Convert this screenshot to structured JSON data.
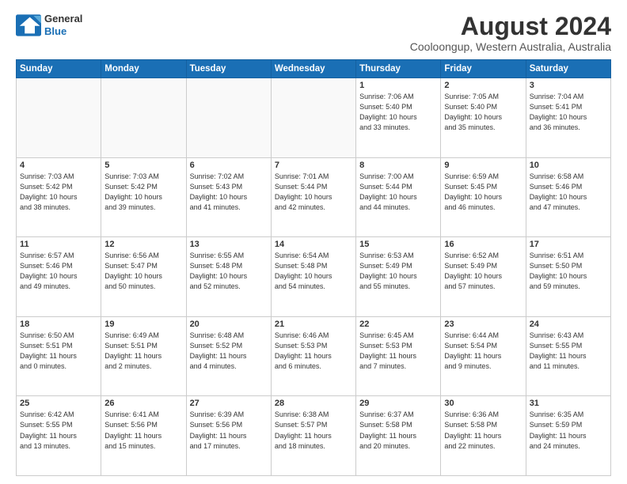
{
  "header": {
    "logo_line1": "General",
    "logo_line2": "Blue",
    "month_title": "August 2024",
    "location": "Cooloongup, Western Australia, Australia"
  },
  "days_of_week": [
    "Sunday",
    "Monday",
    "Tuesday",
    "Wednesday",
    "Thursday",
    "Friday",
    "Saturday"
  ],
  "weeks": [
    [
      {
        "num": "",
        "info": ""
      },
      {
        "num": "",
        "info": ""
      },
      {
        "num": "",
        "info": ""
      },
      {
        "num": "",
        "info": ""
      },
      {
        "num": "1",
        "info": "Sunrise: 7:06 AM\nSunset: 5:40 PM\nDaylight: 10 hours\nand 33 minutes."
      },
      {
        "num": "2",
        "info": "Sunrise: 7:05 AM\nSunset: 5:40 PM\nDaylight: 10 hours\nand 35 minutes."
      },
      {
        "num": "3",
        "info": "Sunrise: 7:04 AM\nSunset: 5:41 PM\nDaylight: 10 hours\nand 36 minutes."
      }
    ],
    [
      {
        "num": "4",
        "info": "Sunrise: 7:03 AM\nSunset: 5:42 PM\nDaylight: 10 hours\nand 38 minutes."
      },
      {
        "num": "5",
        "info": "Sunrise: 7:03 AM\nSunset: 5:42 PM\nDaylight: 10 hours\nand 39 minutes."
      },
      {
        "num": "6",
        "info": "Sunrise: 7:02 AM\nSunset: 5:43 PM\nDaylight: 10 hours\nand 41 minutes."
      },
      {
        "num": "7",
        "info": "Sunrise: 7:01 AM\nSunset: 5:44 PM\nDaylight: 10 hours\nand 42 minutes."
      },
      {
        "num": "8",
        "info": "Sunrise: 7:00 AM\nSunset: 5:44 PM\nDaylight: 10 hours\nand 44 minutes."
      },
      {
        "num": "9",
        "info": "Sunrise: 6:59 AM\nSunset: 5:45 PM\nDaylight: 10 hours\nand 46 minutes."
      },
      {
        "num": "10",
        "info": "Sunrise: 6:58 AM\nSunset: 5:46 PM\nDaylight: 10 hours\nand 47 minutes."
      }
    ],
    [
      {
        "num": "11",
        "info": "Sunrise: 6:57 AM\nSunset: 5:46 PM\nDaylight: 10 hours\nand 49 minutes."
      },
      {
        "num": "12",
        "info": "Sunrise: 6:56 AM\nSunset: 5:47 PM\nDaylight: 10 hours\nand 50 minutes."
      },
      {
        "num": "13",
        "info": "Sunrise: 6:55 AM\nSunset: 5:48 PM\nDaylight: 10 hours\nand 52 minutes."
      },
      {
        "num": "14",
        "info": "Sunrise: 6:54 AM\nSunset: 5:48 PM\nDaylight: 10 hours\nand 54 minutes."
      },
      {
        "num": "15",
        "info": "Sunrise: 6:53 AM\nSunset: 5:49 PM\nDaylight: 10 hours\nand 55 minutes."
      },
      {
        "num": "16",
        "info": "Sunrise: 6:52 AM\nSunset: 5:49 PM\nDaylight: 10 hours\nand 57 minutes."
      },
      {
        "num": "17",
        "info": "Sunrise: 6:51 AM\nSunset: 5:50 PM\nDaylight: 10 hours\nand 59 minutes."
      }
    ],
    [
      {
        "num": "18",
        "info": "Sunrise: 6:50 AM\nSunset: 5:51 PM\nDaylight: 11 hours\nand 0 minutes."
      },
      {
        "num": "19",
        "info": "Sunrise: 6:49 AM\nSunset: 5:51 PM\nDaylight: 11 hours\nand 2 minutes."
      },
      {
        "num": "20",
        "info": "Sunrise: 6:48 AM\nSunset: 5:52 PM\nDaylight: 11 hours\nand 4 minutes."
      },
      {
        "num": "21",
        "info": "Sunrise: 6:46 AM\nSunset: 5:53 PM\nDaylight: 11 hours\nand 6 minutes."
      },
      {
        "num": "22",
        "info": "Sunrise: 6:45 AM\nSunset: 5:53 PM\nDaylight: 11 hours\nand 7 minutes."
      },
      {
        "num": "23",
        "info": "Sunrise: 6:44 AM\nSunset: 5:54 PM\nDaylight: 11 hours\nand 9 minutes."
      },
      {
        "num": "24",
        "info": "Sunrise: 6:43 AM\nSunset: 5:55 PM\nDaylight: 11 hours\nand 11 minutes."
      }
    ],
    [
      {
        "num": "25",
        "info": "Sunrise: 6:42 AM\nSunset: 5:55 PM\nDaylight: 11 hours\nand 13 minutes."
      },
      {
        "num": "26",
        "info": "Sunrise: 6:41 AM\nSunset: 5:56 PM\nDaylight: 11 hours\nand 15 minutes."
      },
      {
        "num": "27",
        "info": "Sunrise: 6:39 AM\nSunset: 5:56 PM\nDaylight: 11 hours\nand 17 minutes."
      },
      {
        "num": "28",
        "info": "Sunrise: 6:38 AM\nSunset: 5:57 PM\nDaylight: 11 hours\nand 18 minutes."
      },
      {
        "num": "29",
        "info": "Sunrise: 6:37 AM\nSunset: 5:58 PM\nDaylight: 11 hours\nand 20 minutes."
      },
      {
        "num": "30",
        "info": "Sunrise: 6:36 AM\nSunset: 5:58 PM\nDaylight: 11 hours\nand 22 minutes."
      },
      {
        "num": "31",
        "info": "Sunrise: 6:35 AM\nSunset: 5:59 PM\nDaylight: 11 hours\nand 24 minutes."
      }
    ]
  ]
}
